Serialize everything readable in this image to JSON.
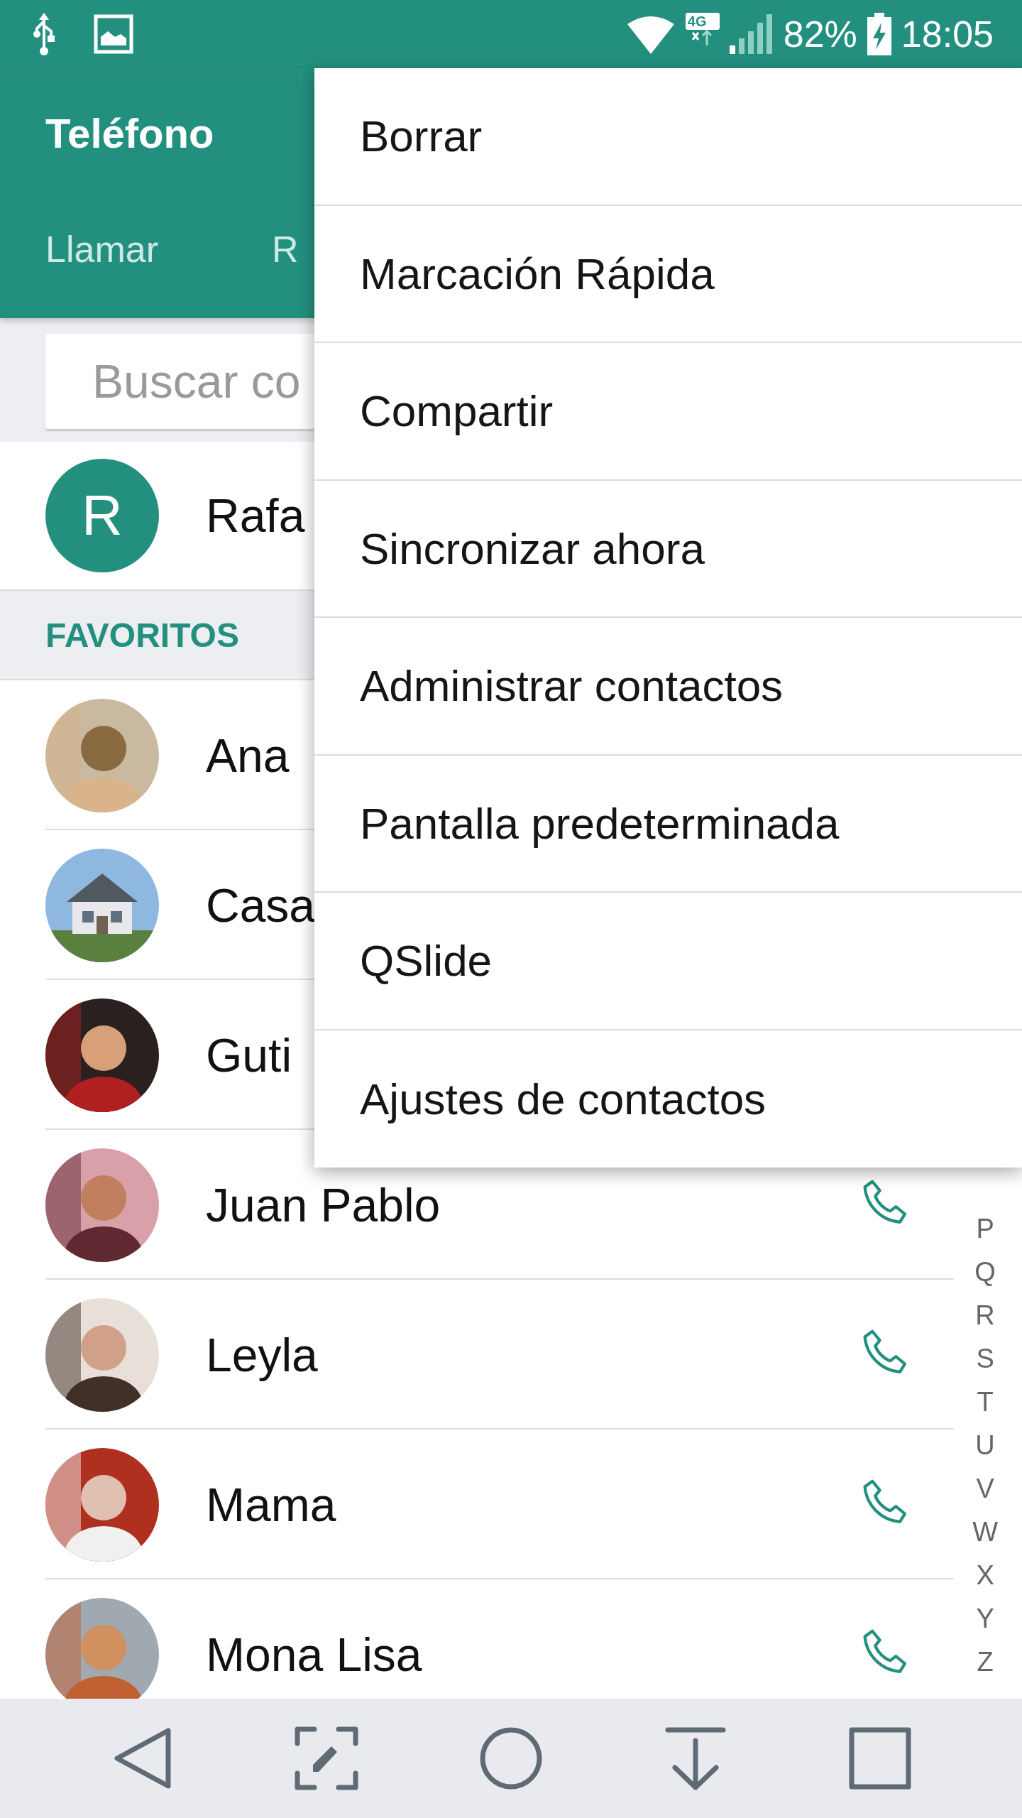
{
  "status_bar": {
    "network": "4G",
    "battery": "82%",
    "time": "18:05"
  },
  "app_bar": {
    "title": "Teléfono",
    "tabs": [
      {
        "label": "Llamar"
      },
      {
        "label": "R"
      }
    ]
  },
  "search": {
    "placeholder": "Buscar co"
  },
  "profile": {
    "avatar": {
      "kind": "letter",
      "initial": "R"
    },
    "name": "Rafa"
  },
  "section_header": "FAVORITOS",
  "contacts": [
    {
      "name": "Ana",
      "call_icon": false
    },
    {
      "name": "Casa",
      "call_icon": false
    },
    {
      "name": "Guti",
      "call_icon": false
    },
    {
      "name": "Juan Pablo",
      "call_icon": true
    },
    {
      "name": "Leyla",
      "call_icon": true
    },
    {
      "name": "Mama",
      "call_icon": true
    },
    {
      "name": "Mona Lisa",
      "call_icon": true
    }
  ],
  "index_letters": [
    "P",
    "Q",
    "R",
    "S",
    "T",
    "U",
    "V",
    "W",
    "X",
    "Y",
    "Z"
  ],
  "menu": [
    "Borrar",
    "Marcación Rápida",
    "Compartir",
    "Sincronizar ahora",
    "Administrar contactos",
    "Pantalla predeterminada",
    "QSlide",
    "Ajustes de contactos"
  ]
}
